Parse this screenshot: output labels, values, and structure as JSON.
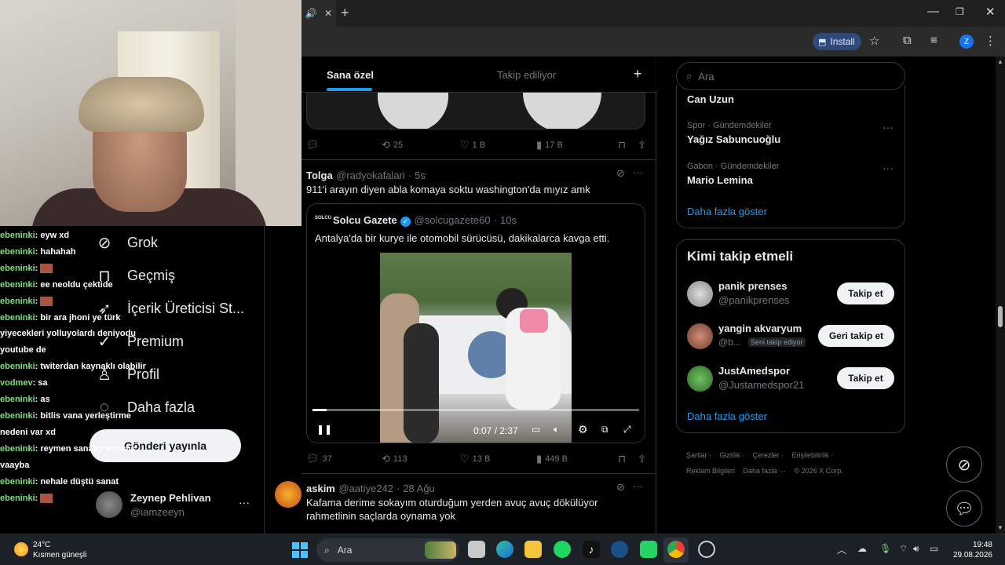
{
  "browser": {
    "new_tab": "+",
    "install_label": "Install",
    "profile_initial": "Z",
    "window_controls": [
      "—",
      "❐",
      "✕"
    ]
  },
  "chat": [
    {
      "user": "ebeninki",
      "msg": "eyw xd"
    },
    {
      "user": "ebeninki",
      "msg": "hahahah"
    },
    {
      "user": "ebeninki",
      "msg": "",
      "emote": true
    },
    {
      "user": "ebeninki",
      "msg": "ee neoldu çektide"
    },
    {
      "user": "ebeninki",
      "msg": "",
      "emote": true
    },
    {
      "user": "ebeninki",
      "msg": "bir ara jhoni ye türk"
    },
    {
      "user": "",
      "msg": "yiyecekleri yolluyolardı deniyodu"
    },
    {
      "user": "",
      "msg": "youtube de"
    },
    {
      "user": "ebeninki",
      "msg": "twiterdan kaynaklı olabilir"
    },
    {
      "user": "vodmev",
      "msg": "sa"
    },
    {
      "user": "ebeninki",
      "msg": "as"
    },
    {
      "user": "ebeninki",
      "msg": "bitlis vana yerleştirme"
    },
    {
      "user": "",
      "msg": "nedeni var xd"
    },
    {
      "user": "ebeninki",
      "msg": "reymen sanatçı mıymış"
    },
    {
      "user": "",
      "msg": "vaayba"
    },
    {
      "user": "ebeninki",
      "msg": "nehale düştü sanat"
    },
    {
      "user": "ebeninki",
      "msg": "",
      "emote": true
    }
  ],
  "nav": {
    "grok": "Grok",
    "history": "Geçmiş",
    "creator": "İçerik Üreticisi St...",
    "premium": "Premium",
    "profile": "Profil",
    "more": "Daha fazla",
    "post": "Gönderi yayınla"
  },
  "account": {
    "name": "Zeynep Pehlivan",
    "handle": "@iamzeeyn",
    "more": "···"
  },
  "timeline": {
    "tab_for_you": "Sana özel",
    "tab_following": "Takip ediliyor",
    "plus": "+",
    "top_actions": {
      "replies": "",
      "reposts": "25",
      "likes": "1 B",
      "views": "17 B"
    },
    "tweet1": {
      "name": "Tolga",
      "handle": "@radyokafalari",
      "time": "· 5s",
      "text": "911'i arayın diyen abla komaya soktu washington'da mıyız amk",
      "quote": {
        "logo": "SOLCU",
        "name": "Solcu Gazete",
        "handle": "@solcugazete60",
        "time": "· 10s",
        "text": "Antalya'da bir kurye ile otomobil sürücüsü, dakikalarca kavga etti.",
        "video_time": "0:07 / 2:37",
        "video_progress": 0.044
      },
      "actions": {
        "replies": "37",
        "reposts": "113",
        "likes": "13 B",
        "views": "449 B"
      }
    },
    "tweet2": {
      "name": "askim",
      "handle": "@aatiye242",
      "time": "· 28 Ağu",
      "text1": "Kafama derime sokayım oturduğum yerden avuç avuç dökülüyor",
      "text2": "rahmetlinin saçlarda oynama yok"
    }
  },
  "sidebar": {
    "search_placeholder": "Ara",
    "trends": [
      {
        "category": "",
        "name": "Can Uzun"
      },
      {
        "category": "Spor · Gündemdekiler",
        "name": "Yağız Sabuncuoğlu"
      },
      {
        "category": "Gabon · Gündemdekiler",
        "name": "Mario Lemina"
      }
    ],
    "show_more": "Daha fazla göster",
    "who_title": "Kimi takip etmeli",
    "who": [
      {
        "name": "panik prenses",
        "handle": "@panikprenses",
        "button": "Takip et",
        "badge": ""
      },
      {
        "name": "yangin akvaryum",
        "handle": "@b...",
        "button": "Geri takip et",
        "badge": "Seni takip ediyor"
      },
      {
        "name": "JustAmedspor",
        "handle": "@Justamedspor21",
        "button": "Takip et",
        "badge": ""
      }
    ],
    "who_show_more": "Daha fazla göster",
    "footer": [
      "Şartlar",
      "Gizlilik",
      "Çerezler",
      "Erişilebilirlik",
      "Reklam Bilgileri",
      "Daha fazla ···",
      "© 2026 X Corp."
    ]
  },
  "taskbar": {
    "temp": "24°C",
    "weather": "Kısmen güneşli",
    "search": "Ara",
    "time": "19:48",
    "date": "29.08.2026"
  }
}
